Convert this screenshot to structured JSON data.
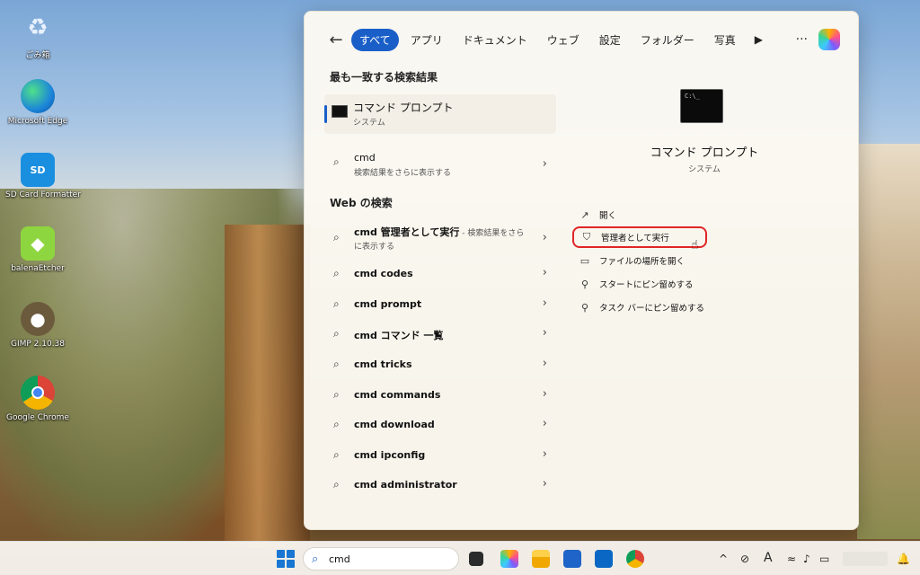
{
  "desktop": {
    "icons": [
      {
        "label": "ごみ箱",
        "icon": "recycle-bin-icon"
      },
      {
        "label": "Microsoft Edge",
        "icon": "edge-icon"
      },
      {
        "label": "SD Card Formatter",
        "icon": "sd-card-icon"
      },
      {
        "label": "balenaEtcher",
        "icon": "etcher-icon"
      },
      {
        "label": "GIMP 2.10.38",
        "icon": "gimp-icon"
      },
      {
        "label": "Google Chrome",
        "icon": "chrome-icon"
      }
    ]
  },
  "search_panel": {
    "tabs": [
      "すべて",
      "アプリ",
      "ドキュメント",
      "ウェブ",
      "設定",
      "フォルダー",
      "写真"
    ],
    "active_tab": "すべて",
    "more_tabs_glyph": "▶",
    "overflow_glyph": "···",
    "best_match_heading": "最も一致する検索結果",
    "best_match": {
      "title": "コマンド プロンプト",
      "subtitle": "システム"
    },
    "search_results_row": {
      "text": "cmd",
      "subtitle": "検索結果をさらに表示する"
    },
    "web_heading": "Web の検索",
    "web_rows": [
      {
        "bold": "cmd 管理者として実行",
        "suffix": " - 検索結果をさら",
        "line2": "に表示する"
      },
      {
        "bold": "cmd codes"
      },
      {
        "bold": "cmd prompt"
      },
      {
        "bold": "cmd コマンド 一覧"
      },
      {
        "bold": "cmd tricks"
      },
      {
        "bold": "cmd commands"
      },
      {
        "bold": "cmd download"
      },
      {
        "bold": "cmd ipconfig"
      },
      {
        "bold": "cmd administrator"
      }
    ],
    "preview": {
      "title": "コマンド プロンプト",
      "subtitle": "システム",
      "icon_text": "C:\\_",
      "actions": [
        {
          "label": "開く",
          "icon": "open-icon"
        },
        {
          "label": "管理者として実行",
          "icon": "shield-icon",
          "highlighted": true
        },
        {
          "label": "ファイルの場所を開く",
          "icon": "folder-icon"
        },
        {
          "label": "スタートにピン留めする",
          "icon": "pin-icon"
        },
        {
          "label": "タスク バーにピン留めする",
          "icon": "pin-icon"
        }
      ]
    }
  },
  "taskbar": {
    "search_value": "cmd",
    "apps": [
      "task-view-icon",
      "copilot-icon",
      "file-explorer-icon",
      "store-icon",
      "outlook-icon",
      "chrome-icon"
    ],
    "tray": {
      "chevron": "^",
      "ime": "A"
    }
  },
  "colors": {
    "accent": "#1a5fc8",
    "highlight_border": "#e02626"
  }
}
